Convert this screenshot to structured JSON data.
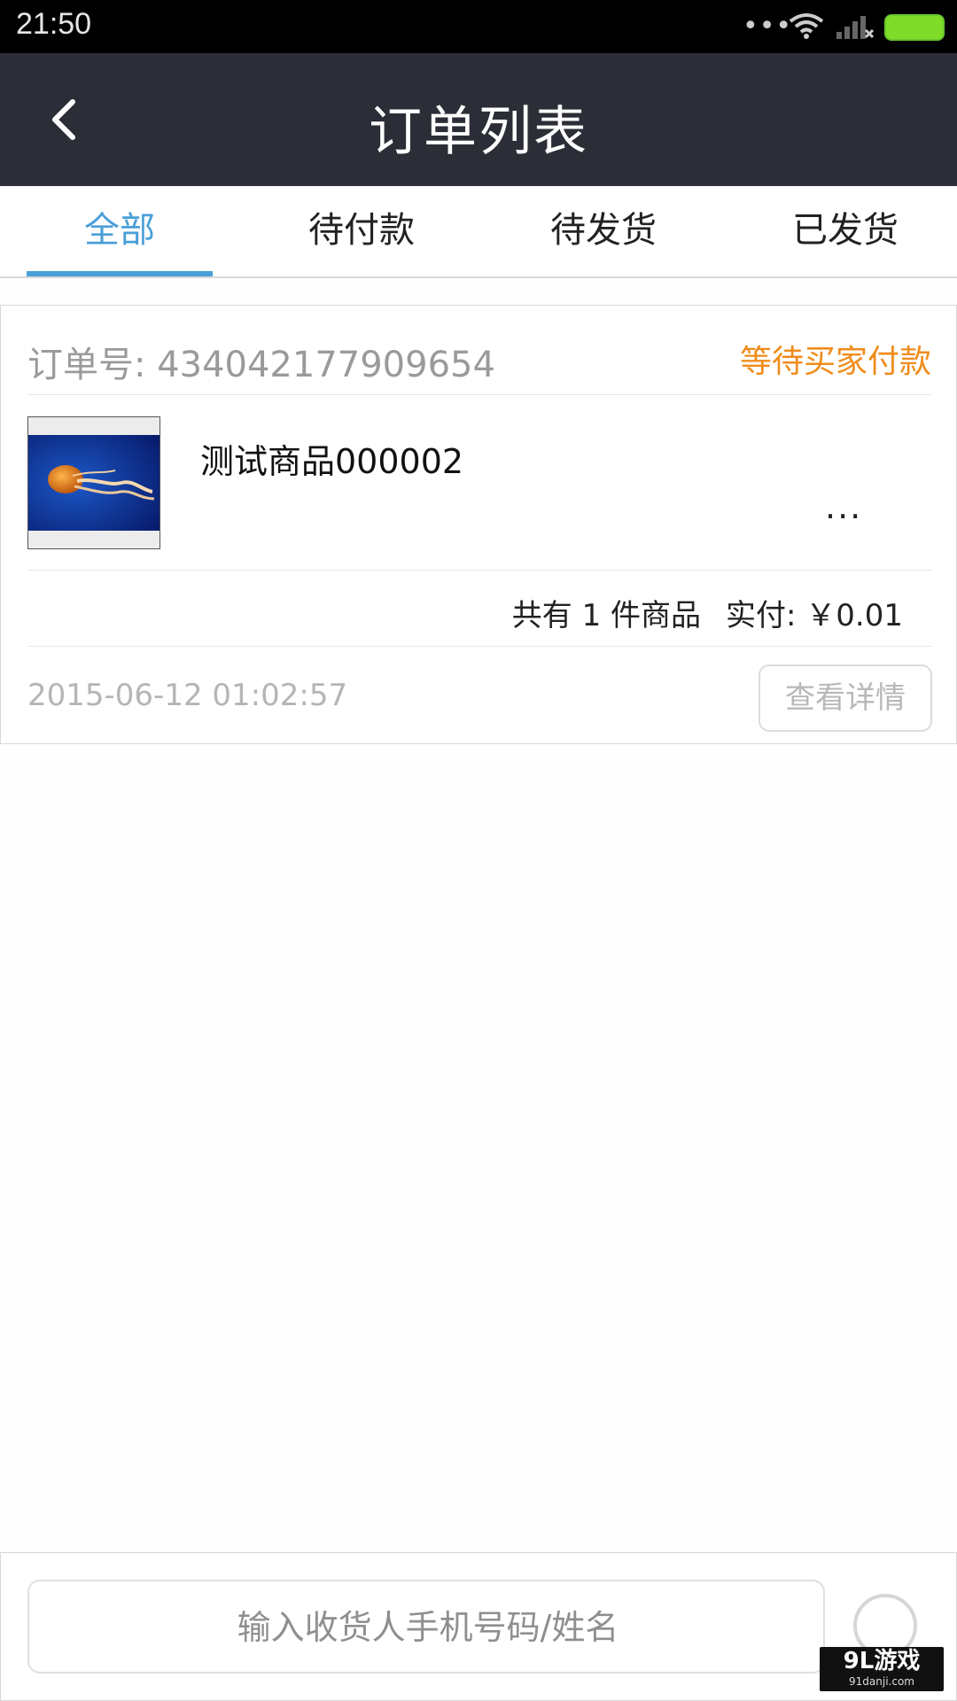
{
  "status_bar": {
    "time": "21:50",
    "dots": "•••",
    "icons": [
      "wifi-icon",
      "signal-icon",
      "battery-icon"
    ],
    "battery_color": "#7fdd2a"
  },
  "header": {
    "title": "订单列表",
    "back_icon": "chevron-left-icon",
    "background": "#2b2e36"
  },
  "tabs": [
    {
      "label": "全部",
      "active": true
    },
    {
      "label": "待付款",
      "active": false
    },
    {
      "label": "待发货",
      "active": false
    },
    {
      "label": "已发货",
      "active": false
    }
  ],
  "accent_color": "#4a9fd8",
  "order": {
    "order_number_label": "订单号: 434042177909654",
    "status": "等待买家付款",
    "status_color": "#f08c1c",
    "product_name": "测试商品000002",
    "more": "...",
    "count_text": "共有 1 件商品",
    "paid_text": "实付: ￥0.01",
    "date": "2015-06-12 01:02:57",
    "detail_button": "查看详情"
  },
  "search": {
    "placeholder": "输入收货人手机号码/姓名",
    "icon": "search-icon"
  },
  "watermark": {
    "main": "9L游戏",
    "sub": "91danji.com"
  }
}
